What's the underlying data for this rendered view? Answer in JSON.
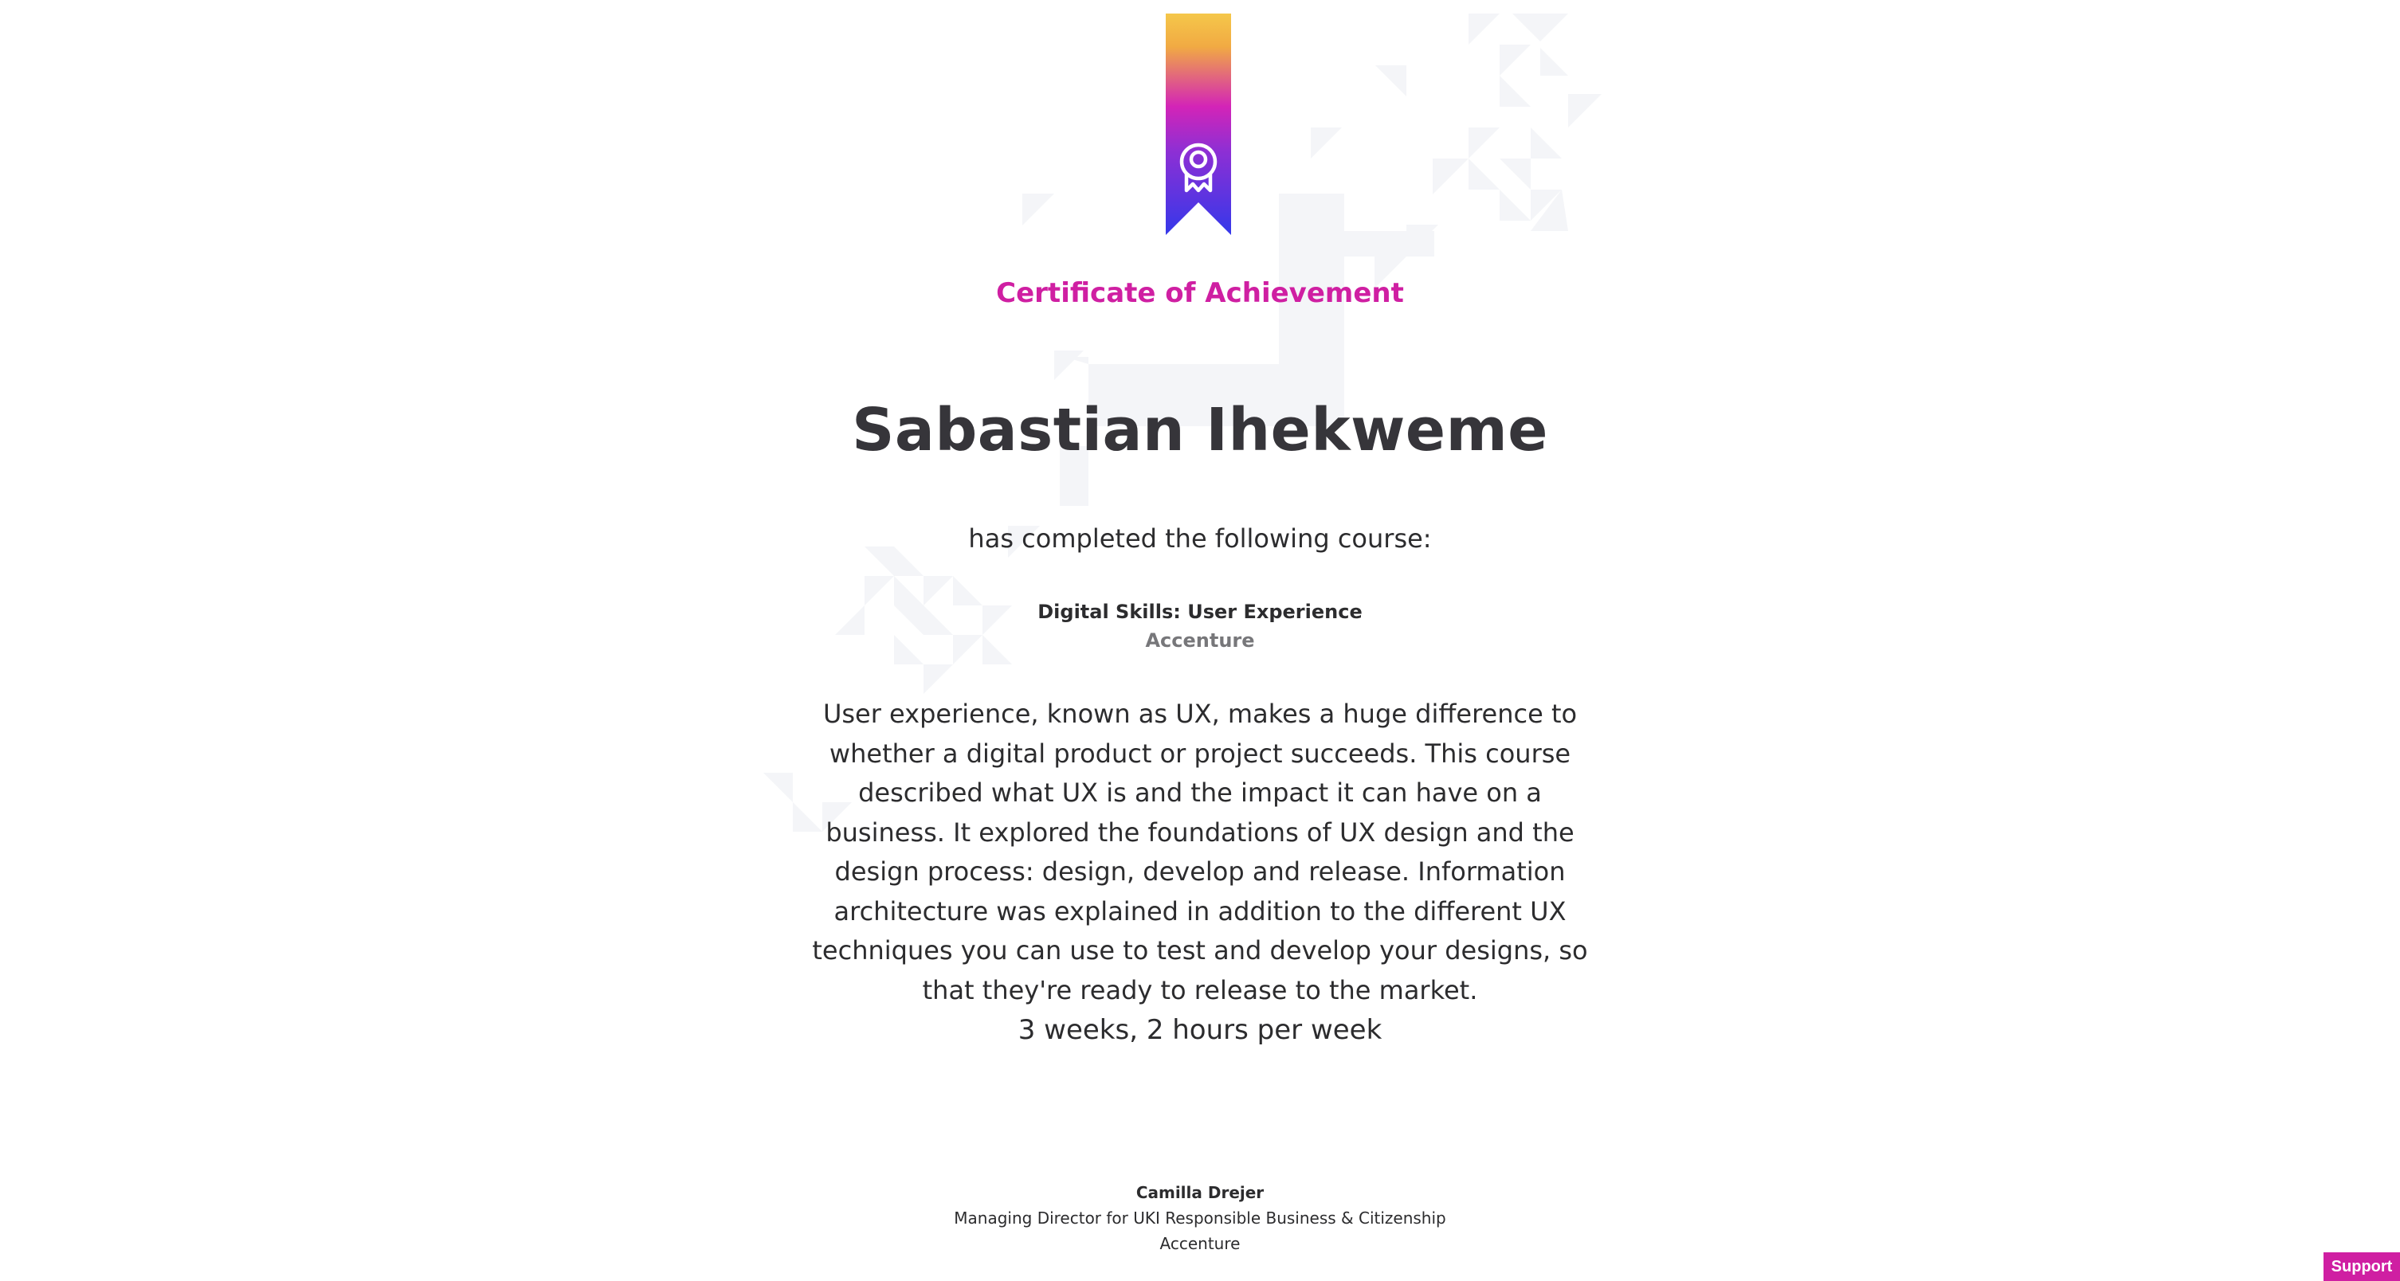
{
  "certificate": {
    "title": "Certificate of Achievement",
    "recipient_name": "Sabastian Ihekweme",
    "completed_text": "has completed the following course:",
    "course_name": "Digital Skills: User Experience",
    "course_organization": "Accenture",
    "description": "User experience, known as UX, makes a huge difference to whether a digital product or project succeeds. This course described what UX is and the impact it can have on a business. It explored the foundations of UX design and the design process: design, develop and release. Information architecture was explained in addition to the different UX techniques you can use to test and develop your designs, so that they're ready to release to the market.",
    "duration": "3 weeks, 2 hours per week"
  },
  "signatory": {
    "name": "Camilla Drejer",
    "role": "Managing Director for UKI Responsible Business & Citizenship",
    "organization": "Accenture"
  },
  "support": {
    "label": "Support"
  },
  "icons": {
    "ribbon": "award-ribbon-icon",
    "badge": "award-badge-icon"
  },
  "colors": {
    "accent": "#cf1fa2",
    "ribbon_top": "#f5c74a",
    "ribbon_middle": "#d324b7",
    "ribbon_bottom": "#3438ea",
    "pattern": "#f4f5f8"
  }
}
